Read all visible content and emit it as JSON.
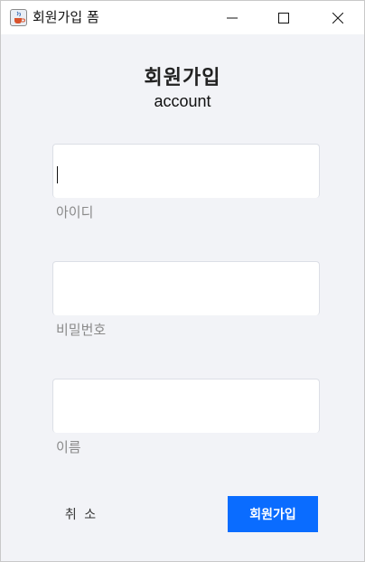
{
  "window": {
    "title": "회원가입 폼",
    "app_icon": "java-cup-icon",
    "controls": [
      "minimize-icon",
      "maximize-icon",
      "close-icon"
    ]
  },
  "form": {
    "title": "회원가입",
    "subtitle": "account",
    "fields": [
      {
        "label": "아이디",
        "value": "",
        "focused": true
      },
      {
        "label": "비밀번호",
        "value": "",
        "focused": false
      },
      {
        "label": "이름",
        "value": "",
        "focused": false
      }
    ],
    "cancel_label": "취 소",
    "submit_label": "회원가입"
  },
  "colors": {
    "background": "#f2f3f7",
    "primary_button": "#0a6cff",
    "label_text": "#8a8a8a"
  }
}
